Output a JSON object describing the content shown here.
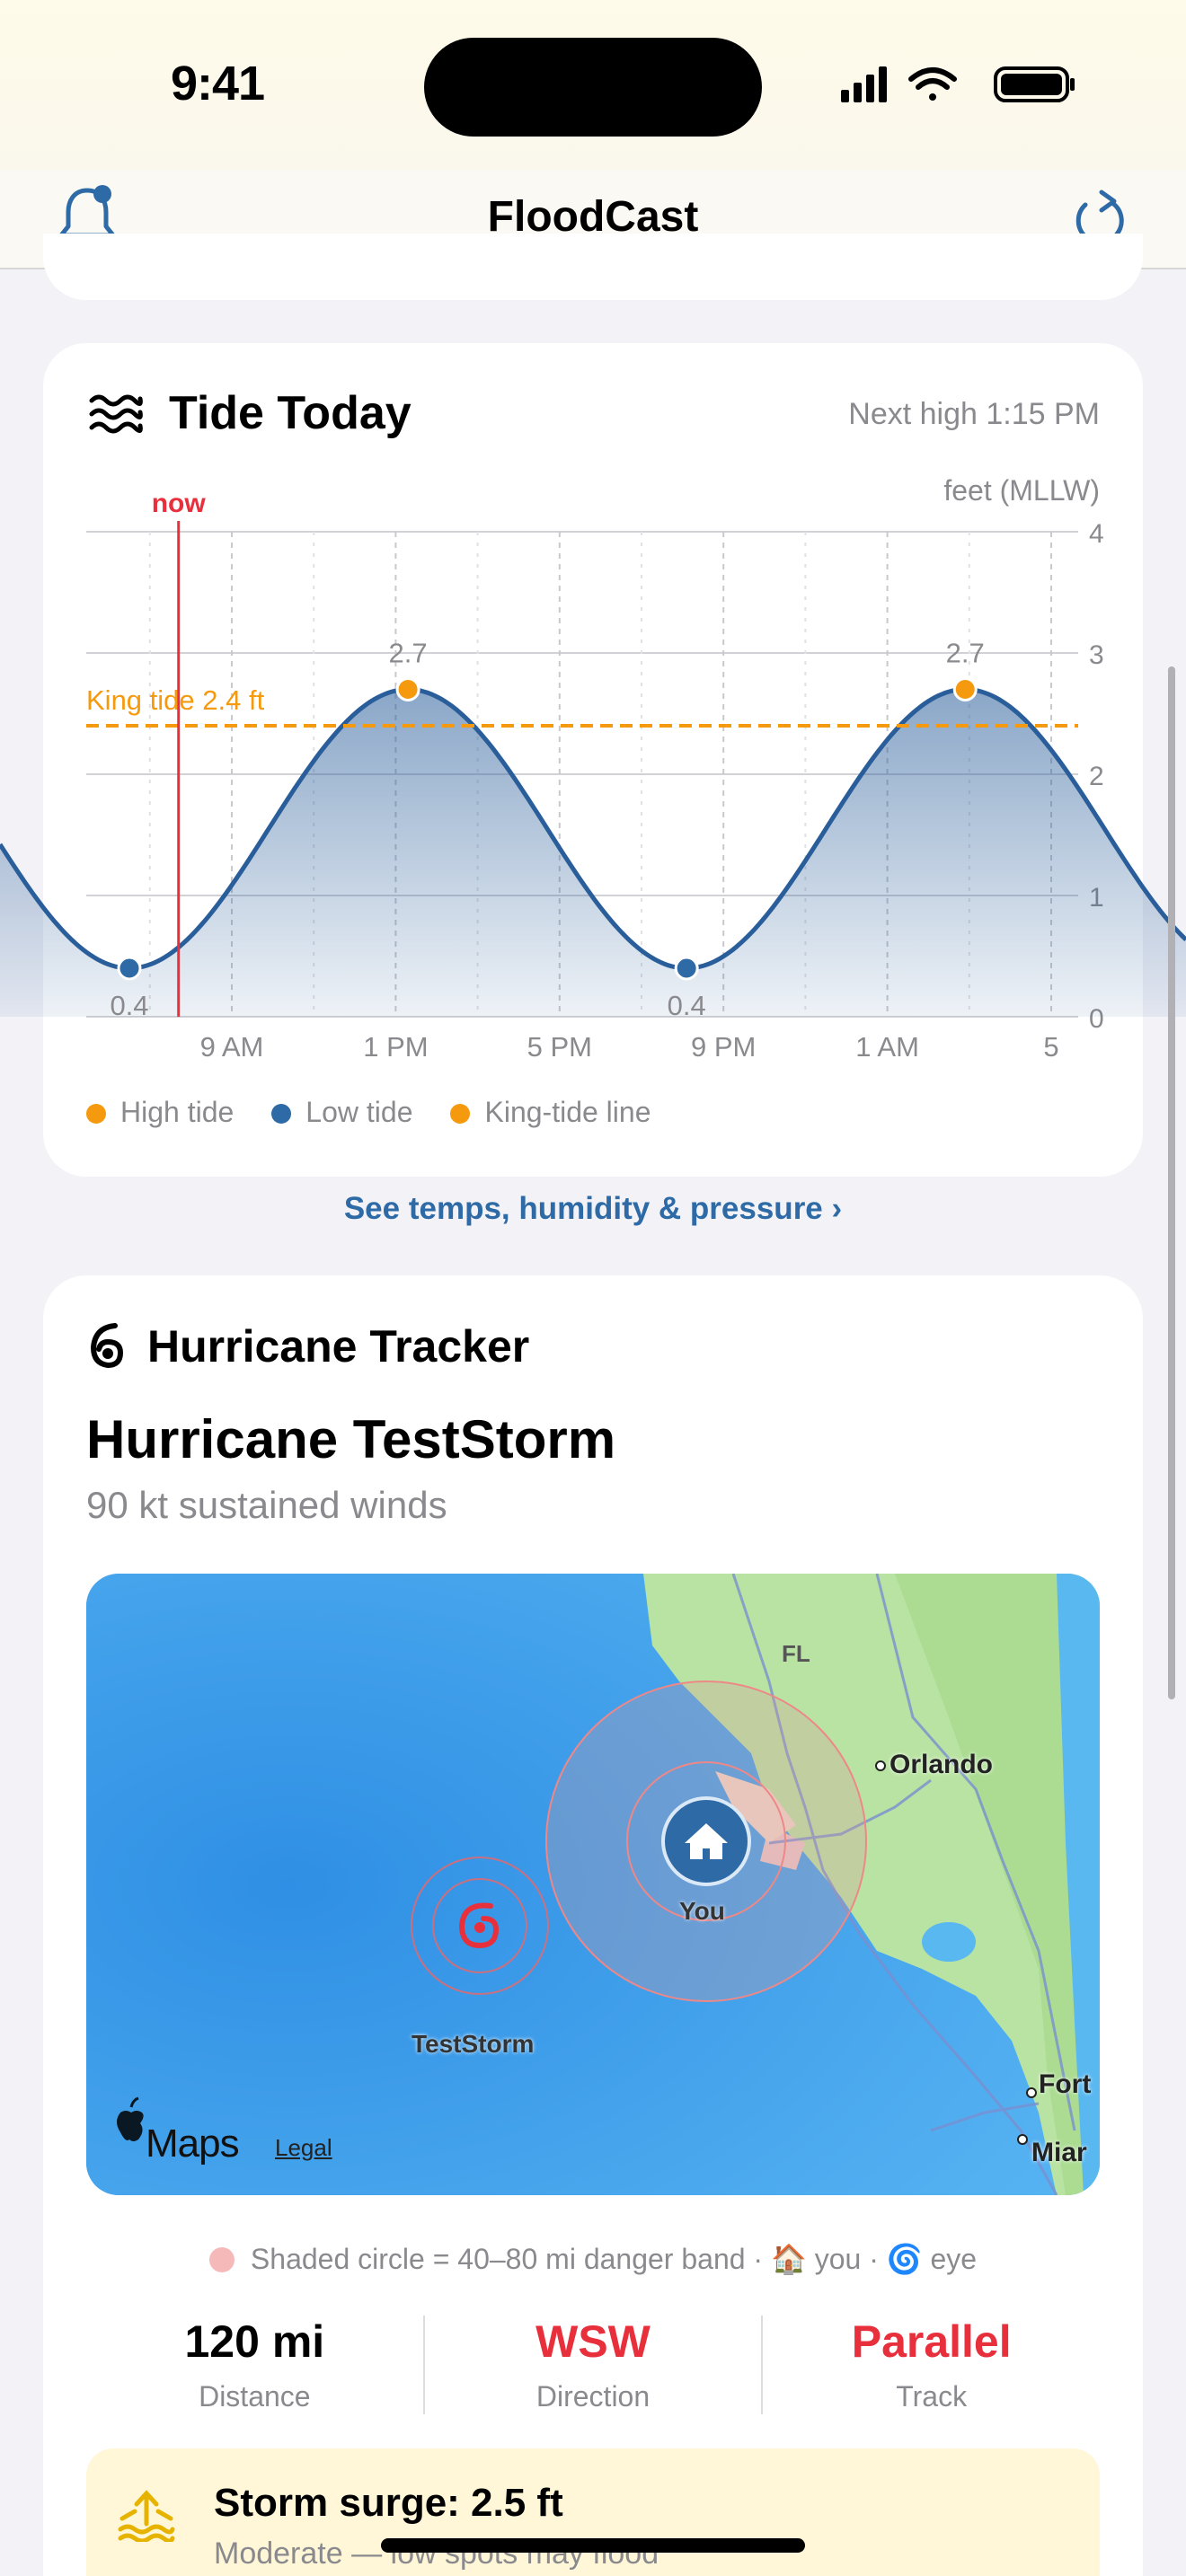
{
  "status": {
    "time": "9:41"
  },
  "nav": {
    "title": "FloodCast"
  },
  "tide": {
    "title": "Tide Today",
    "next_high": "Next high 1:15 PM",
    "unit_label": "feet (MLLW)",
    "now_label": "now",
    "king_tide_label": "King tide 2.4 ft",
    "legend": {
      "high": "High tide",
      "low": "Low tide",
      "king": "King-tide line"
    },
    "colors": {
      "high": "#f59a0e",
      "low": "#2e6aa6",
      "curve": "#2a5e9a",
      "now": "#e8303d",
      "king": "#f59a0e"
    }
  },
  "chart_data": {
    "type": "area",
    "ylabel": "feet (MLLW)",
    "ylim": [
      0,
      4
    ],
    "y_ticks": [
      "0",
      "1",
      "2",
      "3",
      "4"
    ],
    "x_ticks": [
      "9 AM",
      "1 PM",
      "5 PM",
      "9 PM",
      "1 AM",
      "5"
    ],
    "extremes": [
      {
        "kind": "low",
        "label": "0.4",
        "value": 0.4
      },
      {
        "kind": "high",
        "label": "2.7",
        "value": 2.7
      },
      {
        "kind": "low",
        "label": "0.4",
        "value": 0.4
      },
      {
        "kind": "high",
        "label": "2.7",
        "value": 2.7
      }
    ],
    "king_tide": 2.4
  },
  "see_more": "See temps, humidity & pressure",
  "hurricane": {
    "header": "Hurricane Tracker",
    "name": "Hurricane TestStorm",
    "winds": "90 kt sustained winds",
    "map": {
      "state_label": "FL",
      "city_orlando": "Orlando",
      "city_fort": "Fort",
      "city_miami": "Miar",
      "you_label": "You",
      "storm_label": "TestStorm",
      "maps_brand": "Maps",
      "legal": "Legal"
    },
    "map_note": "Shaded circle = 40–80 mi danger band · 🏠 you · 🌀 eye",
    "stats": [
      {
        "value": "120 mi",
        "label": "Distance",
        "color": "#000000"
      },
      {
        "value": "WSW",
        "label": "Direction",
        "color": "#e8303d"
      },
      {
        "value": "Parallel",
        "label": "Track",
        "color": "#e8303d"
      }
    ],
    "surge": {
      "title": "Storm surge: 2.5 ft",
      "subtitle": "Moderate — low spots may flood"
    }
  }
}
